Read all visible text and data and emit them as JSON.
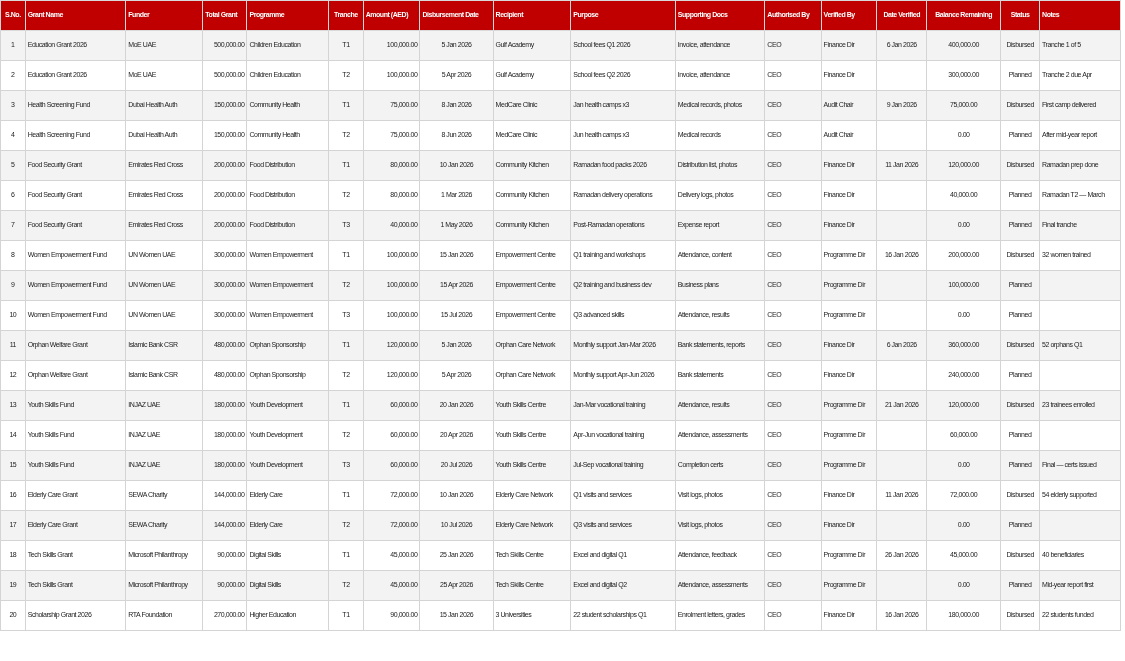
{
  "table": {
    "columns": [
      "S.No.",
      "Grant Name",
      "Funder",
      "Total Grant",
      "Programme",
      "Tranche",
      "Amount (AED)",
      "Disbursement Date",
      "Recipient",
      "Purpose",
      "Supporting Docs",
      "Authorised By",
      "Verified By",
      "Date Verified",
      "Balance Remaining",
      "Status",
      "Notes"
    ],
    "rows": [
      {
        "sno": "1",
        "grant_name": "Education Grant 2026",
        "funder": "MoE UAE",
        "total_grant": "500,000.00",
        "programme": "Children Education",
        "tranche": "T1",
        "amount": "100,000.00",
        "disbursement_date": "5 Jan 2026",
        "recipient": "Gulf Academy",
        "purpose": "School fees Q1 2026",
        "supporting_docs": "Invoice, attendance",
        "authorised_by": "CEO",
        "verified_by": "Finance Dir",
        "date_verified": "6 Jan 2026",
        "balance_remaining": "400,000.00",
        "status": "Disbursed",
        "notes": "Tranche 1 of 5"
      },
      {
        "sno": "2",
        "grant_name": "Education Grant 2026",
        "funder": "MoE UAE",
        "total_grant": "500,000.00",
        "programme": "Children Education",
        "tranche": "T2",
        "amount": "100,000.00",
        "disbursement_date": "5 Apr 2026",
        "recipient": "Gulf Academy",
        "purpose": "School fees Q2 2026",
        "supporting_docs": "Invoice, attendance",
        "authorised_by": "CEO",
        "verified_by": "Finance Dir",
        "balance_remaining": "300,000.00",
        "status": "Planned",
        "notes": "Tranche 2 due Apr"
      },
      {
        "sno": "3",
        "grant_name": "Health Screening Fund",
        "funder": "Dubai Health Auth",
        "total_grant": "150,000.00",
        "programme": "Community Health",
        "tranche": "T1",
        "amount": "75,000.00",
        "disbursement_date": "8 Jan 2026",
        "recipient": "MedCare Clinic",
        "purpose": "Jan health camps x3",
        "supporting_docs": "Medical records, photos",
        "authorised_by": "CEO",
        "verified_by": "Audit Chair",
        "date_verified": "9 Jan 2026",
        "balance_remaining": "75,000.00",
        "status": "Disbursed",
        "notes": "First camp delivered"
      },
      {
        "sno": "4",
        "grant_name": "Health Screening Fund",
        "funder": "Dubai Health Auth",
        "total_grant": "150,000.00",
        "programme": "Community Health",
        "tranche": "T2",
        "amount": "75,000.00",
        "disbursement_date": "8 Jun 2026",
        "recipient": "MedCare Clinic",
        "purpose": "Jun health camps x3",
        "supporting_docs": "Medical records",
        "authorised_by": "CEO",
        "verified_by": "Audit Chair",
        "balance_remaining": "0.00",
        "status": "Planned",
        "notes": "After mid-year report"
      },
      {
        "sno": "5",
        "grant_name": "Food Security Grant",
        "funder": "Emirates Red Cross",
        "total_grant": "200,000.00",
        "programme": "Food Distribution",
        "tranche": "T1",
        "amount": "80,000.00",
        "disbursement_date": "10 Jan 2026",
        "recipient": "Community Kitchen",
        "purpose": "Ramadan food packs 2026",
        "supporting_docs": "Distribution list, photos",
        "authorised_by": "CEO",
        "verified_by": "Finance Dir",
        "date_verified": "11 Jan 2026",
        "balance_remaining": "120,000.00",
        "status": "Disbursed",
        "notes": "Ramadan prep done"
      },
      {
        "sno": "6",
        "grant_name": "Food Security Grant",
        "funder": "Emirates Red Cross",
        "total_grant": "200,000.00",
        "programme": "Food Distribution",
        "tranche": "T2",
        "amount": "80,000.00",
        "disbursement_date": "1 Mar 2026",
        "recipient": "Community Kitchen",
        "purpose": "Ramadan delivery operations",
        "supporting_docs": "Delivery logs, photos",
        "authorised_by": "CEO",
        "verified_by": "Finance Dir",
        "balance_remaining": "40,000.00",
        "status": "Planned",
        "notes": "Ramadan T2 — March"
      },
      {
        "sno": "7",
        "grant_name": "Food Security Grant",
        "funder": "Emirates Red Cross",
        "total_grant": "200,000.00",
        "programme": "Food Distribution",
        "tranche": "T3",
        "amount": "40,000.00",
        "disbursement_date": "1 May 2026",
        "recipient": "Community Kitchen",
        "purpose": "Post-Ramadan operations",
        "supporting_docs": "Expense report",
        "authorised_by": "CEO",
        "verified_by": "Finance Dir",
        "balance_remaining": "0.00",
        "status": "Planned",
        "notes": "Final tranche"
      },
      {
        "sno": "8",
        "grant_name": "Women Empowerment Fund",
        "funder": "UN Women UAE",
        "total_grant": "300,000.00",
        "programme": "Women Empowerment",
        "tranche": "T1",
        "amount": "100,000.00",
        "disbursement_date": "15 Jan 2026",
        "recipient": "Empowerment Centre",
        "purpose": "Q1 training and workshops",
        "supporting_docs": "Attendance, content",
        "authorised_by": "CEO",
        "verified_by": "Programme Dir",
        "date_verified": "16 Jan 2026",
        "balance_remaining": "200,000.00",
        "status": "Disbursed",
        "notes": "32 women trained"
      },
      {
        "sno": "9",
        "grant_name": "Women Empowerment Fund",
        "funder": "UN Women UAE",
        "total_grant": "300,000.00",
        "programme": "Women Empowerment",
        "tranche": "T2",
        "amount": "100,000.00",
        "disbursement_date": "15 Apr 2026",
        "recipient": "Empowerment Centre",
        "purpose": "Q2 training and business dev",
        "supporting_docs": "Business plans",
        "authorised_by": "CEO",
        "verified_by": "Programme Dir",
        "balance_remaining": "100,000.00",
        "status": "Planned"
      },
      {
        "sno": "10",
        "grant_name": "Women Empowerment Fund",
        "funder": "UN Women UAE",
        "total_grant": "300,000.00",
        "programme": "Women Empowerment",
        "tranche": "T3",
        "amount": "100,000.00",
        "disbursement_date": "15 Jul 2026",
        "recipient": "Empowerment Centre",
        "purpose": "Q3 advanced skills",
        "supporting_docs": "Attendance, results",
        "authorised_by": "CEO",
        "verified_by": "Programme Dir",
        "balance_remaining": "0.00",
        "status": "Planned"
      },
      {
        "sno": "11",
        "grant_name": "Orphan Welfare Grant",
        "funder": "Islamic Bank CSR",
        "total_grant": "480,000.00",
        "programme": "Orphan Sponsorship",
        "tranche": "T1",
        "amount": "120,000.00",
        "disbursement_date": "5 Jan 2026",
        "recipient": "Orphan Care Network",
        "purpose": "Monthly support Jan-Mar 2026",
        "supporting_docs": "Bank statements, reports",
        "authorised_by": "CEO",
        "verified_by": "Finance Dir",
        "date_verified": "6 Jan 2026",
        "balance_remaining": "360,000.00",
        "status": "Disbursed",
        "notes": "52 orphans Q1"
      },
      {
        "sno": "12",
        "grant_name": "Orphan Welfare Grant",
        "funder": "Islamic Bank CSR",
        "total_grant": "480,000.00",
        "programme": "Orphan Sponsorship",
        "tranche": "T2",
        "amount": "120,000.00",
        "disbursement_date": "5 Apr 2026",
        "recipient": "Orphan Care Network",
        "purpose": "Monthly support Apr-Jun 2026",
        "supporting_docs": "Bank statements",
        "authorised_by": "CEO",
        "verified_by": "Finance Dir",
        "balance_remaining": "240,000.00",
        "status": "Planned"
      },
      {
        "sno": "13",
        "grant_name": "Youth Skills Fund",
        "funder": "INJAZ UAE",
        "total_grant": "180,000.00",
        "programme": "Youth Development",
        "tranche": "T1",
        "amount": "60,000.00",
        "disbursement_date": "20 Jan 2026",
        "recipient": "Youth Skills Centre",
        "purpose": "Jan-Mar vocational training",
        "supporting_docs": "Attendance, results",
        "authorised_by": "CEO",
        "verified_by": "Programme Dir",
        "date_verified": "21 Jan 2026",
        "balance_remaining": "120,000.00",
        "status": "Disbursed",
        "notes": "23 trainees enrolled"
      },
      {
        "sno": "14",
        "grant_name": "Youth Skills Fund",
        "funder": "INJAZ UAE",
        "total_grant": "180,000.00",
        "programme": "Youth Development",
        "tranche": "T2",
        "amount": "60,000.00",
        "disbursement_date": "20 Apr 2026",
        "recipient": "Youth Skills Centre",
        "purpose": "Apr-Jun vocational training",
        "supporting_docs": "Attendance, assessments",
        "authorised_by": "CEO",
        "verified_by": "Programme Dir",
        "balance_remaining": "60,000.00",
        "status": "Planned"
      },
      {
        "sno": "15",
        "grant_name": "Youth Skills Fund",
        "funder": "INJAZ UAE",
        "total_grant": "180,000.00",
        "programme": "Youth Development",
        "tranche": "T3",
        "amount": "60,000.00",
        "disbursement_date": "20 Jul 2026",
        "recipient": "Youth Skills Centre",
        "purpose": "Jul-Sep vocational training",
        "supporting_docs": "Completion certs",
        "authorised_by": "CEO",
        "verified_by": "Programme Dir",
        "balance_remaining": "0.00",
        "status": "Planned",
        "notes": "Final — certs issued"
      },
      {
        "sno": "16",
        "grant_name": "Elderly Care Grant",
        "funder": "SEWA Charity",
        "total_grant": "144,000.00",
        "programme": "Elderly Care",
        "tranche": "T1",
        "amount": "72,000.00",
        "disbursement_date": "10 Jan 2026",
        "recipient": "Elderly Care Network",
        "purpose": "Q1 visits and services",
        "supporting_docs": "Visit logs, photos",
        "authorised_by": "CEO",
        "verified_by": "Finance Dir",
        "date_verified": "11 Jan 2026",
        "balance_remaining": "72,000.00",
        "status": "Disbursed",
        "notes": "54 elderly supported"
      },
      {
        "sno": "17",
        "grant_name": "Elderly Care Grant",
        "funder": "SEWA Charity",
        "total_grant": "144,000.00",
        "programme": "Elderly Care",
        "tranche": "T2",
        "amount": "72,000.00",
        "disbursement_date": "10 Jul 2026",
        "recipient": "Elderly Care Network",
        "purpose": "Q3 visits and services",
        "supporting_docs": "Visit logs, photos",
        "authorised_by": "CEO",
        "verified_by": "Finance Dir",
        "balance_remaining": "0.00",
        "status": "Planned"
      },
      {
        "sno": "18",
        "grant_name": "Tech Skills Grant",
        "funder": "Microsoft Philanthropy",
        "total_grant": "90,000.00",
        "programme": "Digital Skills",
        "tranche": "T1",
        "amount": "45,000.00",
        "disbursement_date": "25 Jan 2026",
        "recipient": "Tech Skills Centre",
        "purpose": "Excel and digital Q1",
        "supporting_docs": "Attendance, feedback",
        "authorised_by": "CEO",
        "verified_by": "Programme Dir",
        "date_verified": "26 Jan 2026",
        "balance_remaining": "45,000.00",
        "status": "Disbursed",
        "notes": "40 beneficiaries"
      },
      {
        "sno": "19",
        "grant_name": "Tech Skills Grant",
        "funder": "Microsoft Philanthropy",
        "total_grant": "90,000.00",
        "programme": "Digital Skills",
        "tranche": "T2",
        "amount": "45,000.00",
        "disbursement_date": "25 Apr 2026",
        "recipient": "Tech Skills Centre",
        "purpose": "Excel and digital Q2",
        "supporting_docs": "Attendance, assessments",
        "authorised_by": "CEO",
        "verified_by": "Programme Dir",
        "balance_remaining": "0.00",
        "status": "Planned",
        "notes": "Mid-year report first"
      },
      {
        "sno": "20",
        "grant_name": "Scholarship Grant 2026",
        "funder": "RTA Foundation",
        "total_grant": "270,000.00",
        "programme": "Higher Education",
        "tranche": "T1",
        "amount": "90,000.00",
        "disbursement_date": "15 Jan 2026",
        "recipient": "3 Universities",
        "purpose": "22 student scholarships Q1",
        "supporting_docs": "Enrolment letters, grades",
        "authorised_by": "CEO",
        "verified_by": "Finance Dir",
        "date_verified": "16 Jan 2026",
        "balance_remaining": "180,000.00",
        "status": "Disbursed",
        "notes": "22 students funded"
      }
    ]
  }
}
